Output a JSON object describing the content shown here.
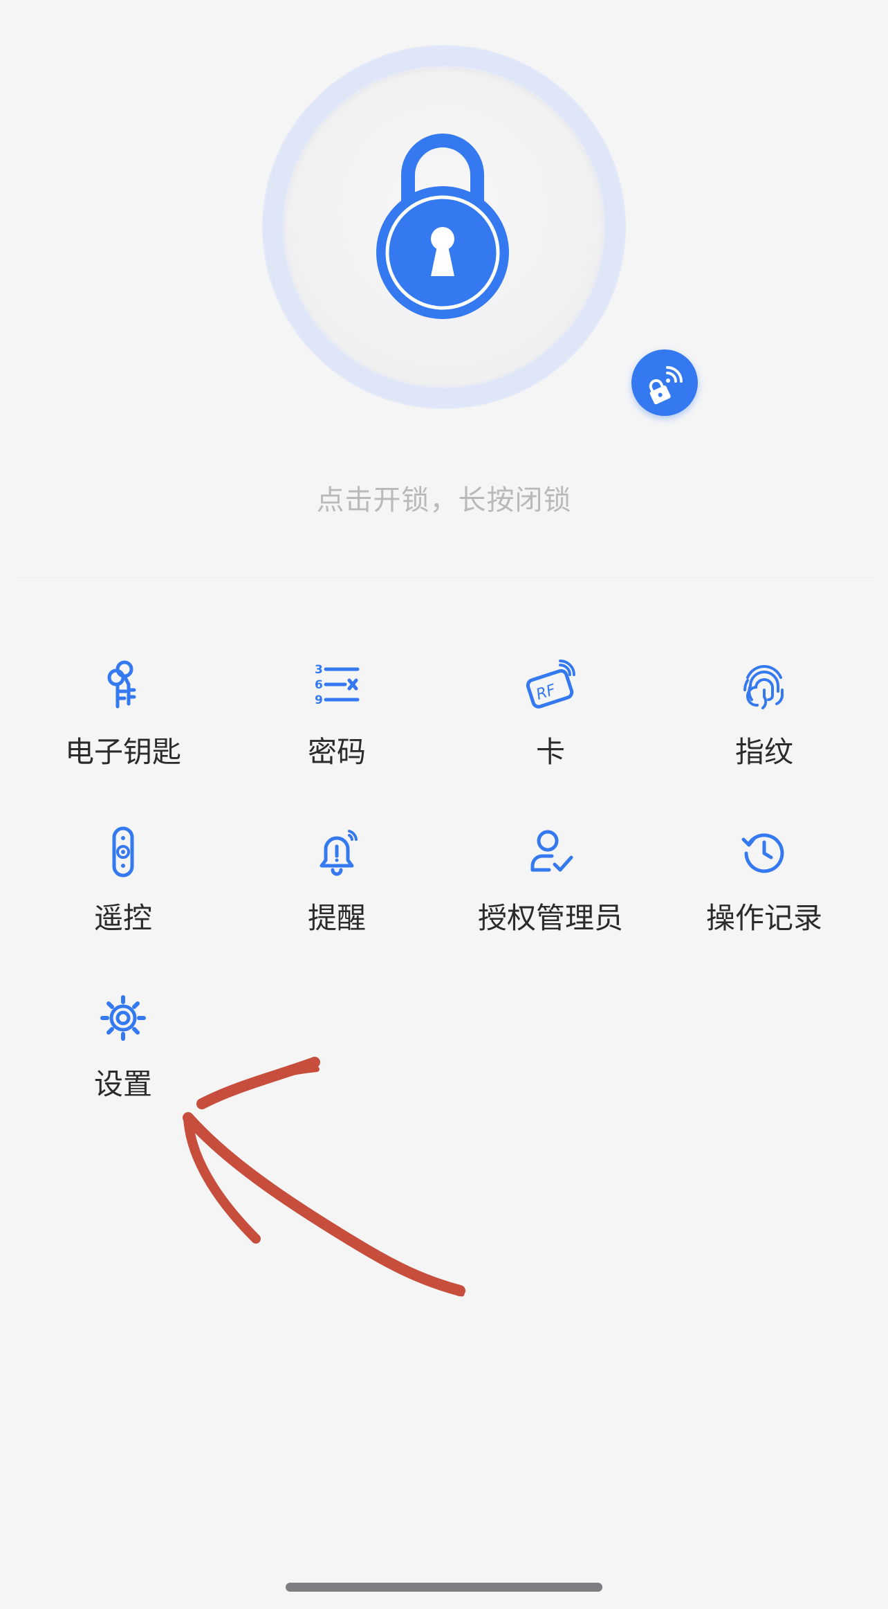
{
  "lock": {
    "hint": "点击开锁，长按闭锁",
    "main_icon": "padlock-icon",
    "quick_icon": "remote-lock-icon",
    "accent_color": "#3479ef"
  },
  "menu": {
    "items": [
      {
        "label": "电子钥匙",
        "icon": "electronic-key-icon"
      },
      {
        "label": "密码",
        "icon": "passcode-icon"
      },
      {
        "label": "卡",
        "icon": "rf-card-icon"
      },
      {
        "label": "指纹",
        "icon": "fingerprint-icon"
      },
      {
        "label": "遥控",
        "icon": "remote-control-icon"
      },
      {
        "label": "提醒",
        "icon": "bell-alert-icon"
      },
      {
        "label": "授权管理员",
        "icon": "authorized-admin-icon"
      },
      {
        "label": "操作记录",
        "icon": "history-icon"
      },
      {
        "label": "设置",
        "icon": "settings-gear-icon"
      }
    ]
  },
  "annotation": {
    "type": "hand-drawn red arrow",
    "color": "#c0301c",
    "points_to": "设置"
  }
}
